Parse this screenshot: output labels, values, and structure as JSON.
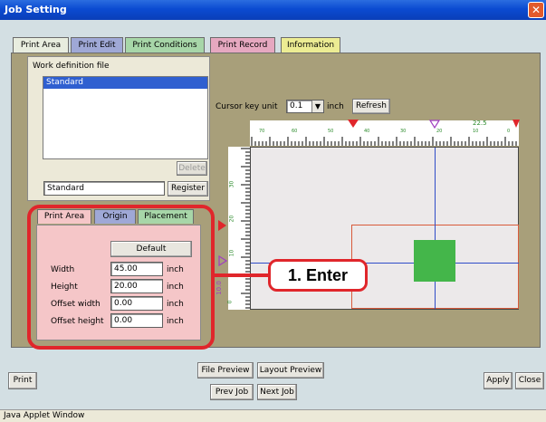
{
  "window": {
    "title": "Job Setting",
    "status": "Java Applet Window"
  },
  "tabs": [
    "Print Area",
    "Print Edit",
    "Print Conditions",
    "Print Record",
    "Information"
  ],
  "tab_colors": [
    "#e8eddf",
    "#9fa8d6",
    "#a7d6a8",
    "#e6a8c0",
    "#ecec93"
  ],
  "work_file": {
    "label": "Work definition file",
    "items": [
      "Standard"
    ],
    "name_value": "Standard",
    "delete_label": "Delete",
    "register_label": "Register"
  },
  "cursor": {
    "label": "Cursor key unit",
    "value": "0.1",
    "unit": "inch",
    "refresh_label": "Refresh"
  },
  "ruler": {
    "top_ticks": [
      "70",
      "60",
      "50",
      "40",
      "30",
      "20",
      "10",
      "0"
    ],
    "top_value": "22.5",
    "left_ticks": [
      "30",
      "20",
      "10",
      "0"
    ],
    "left_value": "10.0"
  },
  "inner_tabs": [
    "Print Area",
    "Origin",
    "Placement"
  ],
  "inner_tab_colors": [
    "#f5c6c8",
    "#9fa8d6",
    "#a7d6a8"
  ],
  "print_area": {
    "default_label": "Default",
    "fields": [
      {
        "label": "Width",
        "value": "45.00",
        "unit": "inch"
      },
      {
        "label": "Height",
        "value": "20.00",
        "unit": "inch"
      },
      {
        "label": "Offset width",
        "value": "0.00",
        "unit": "inch"
      },
      {
        "label": "Offset height",
        "value": "0.00",
        "unit": "inch"
      }
    ]
  },
  "callout": {
    "text": "1. Enter",
    "color": "#e0262b"
  },
  "buttons": {
    "print": "Print",
    "file_preview": "File Preview",
    "layout_preview": "Layout Preview",
    "prev_job": "Prev Job",
    "next_job": "Next Job",
    "apply": "Apply",
    "close": "Close"
  }
}
